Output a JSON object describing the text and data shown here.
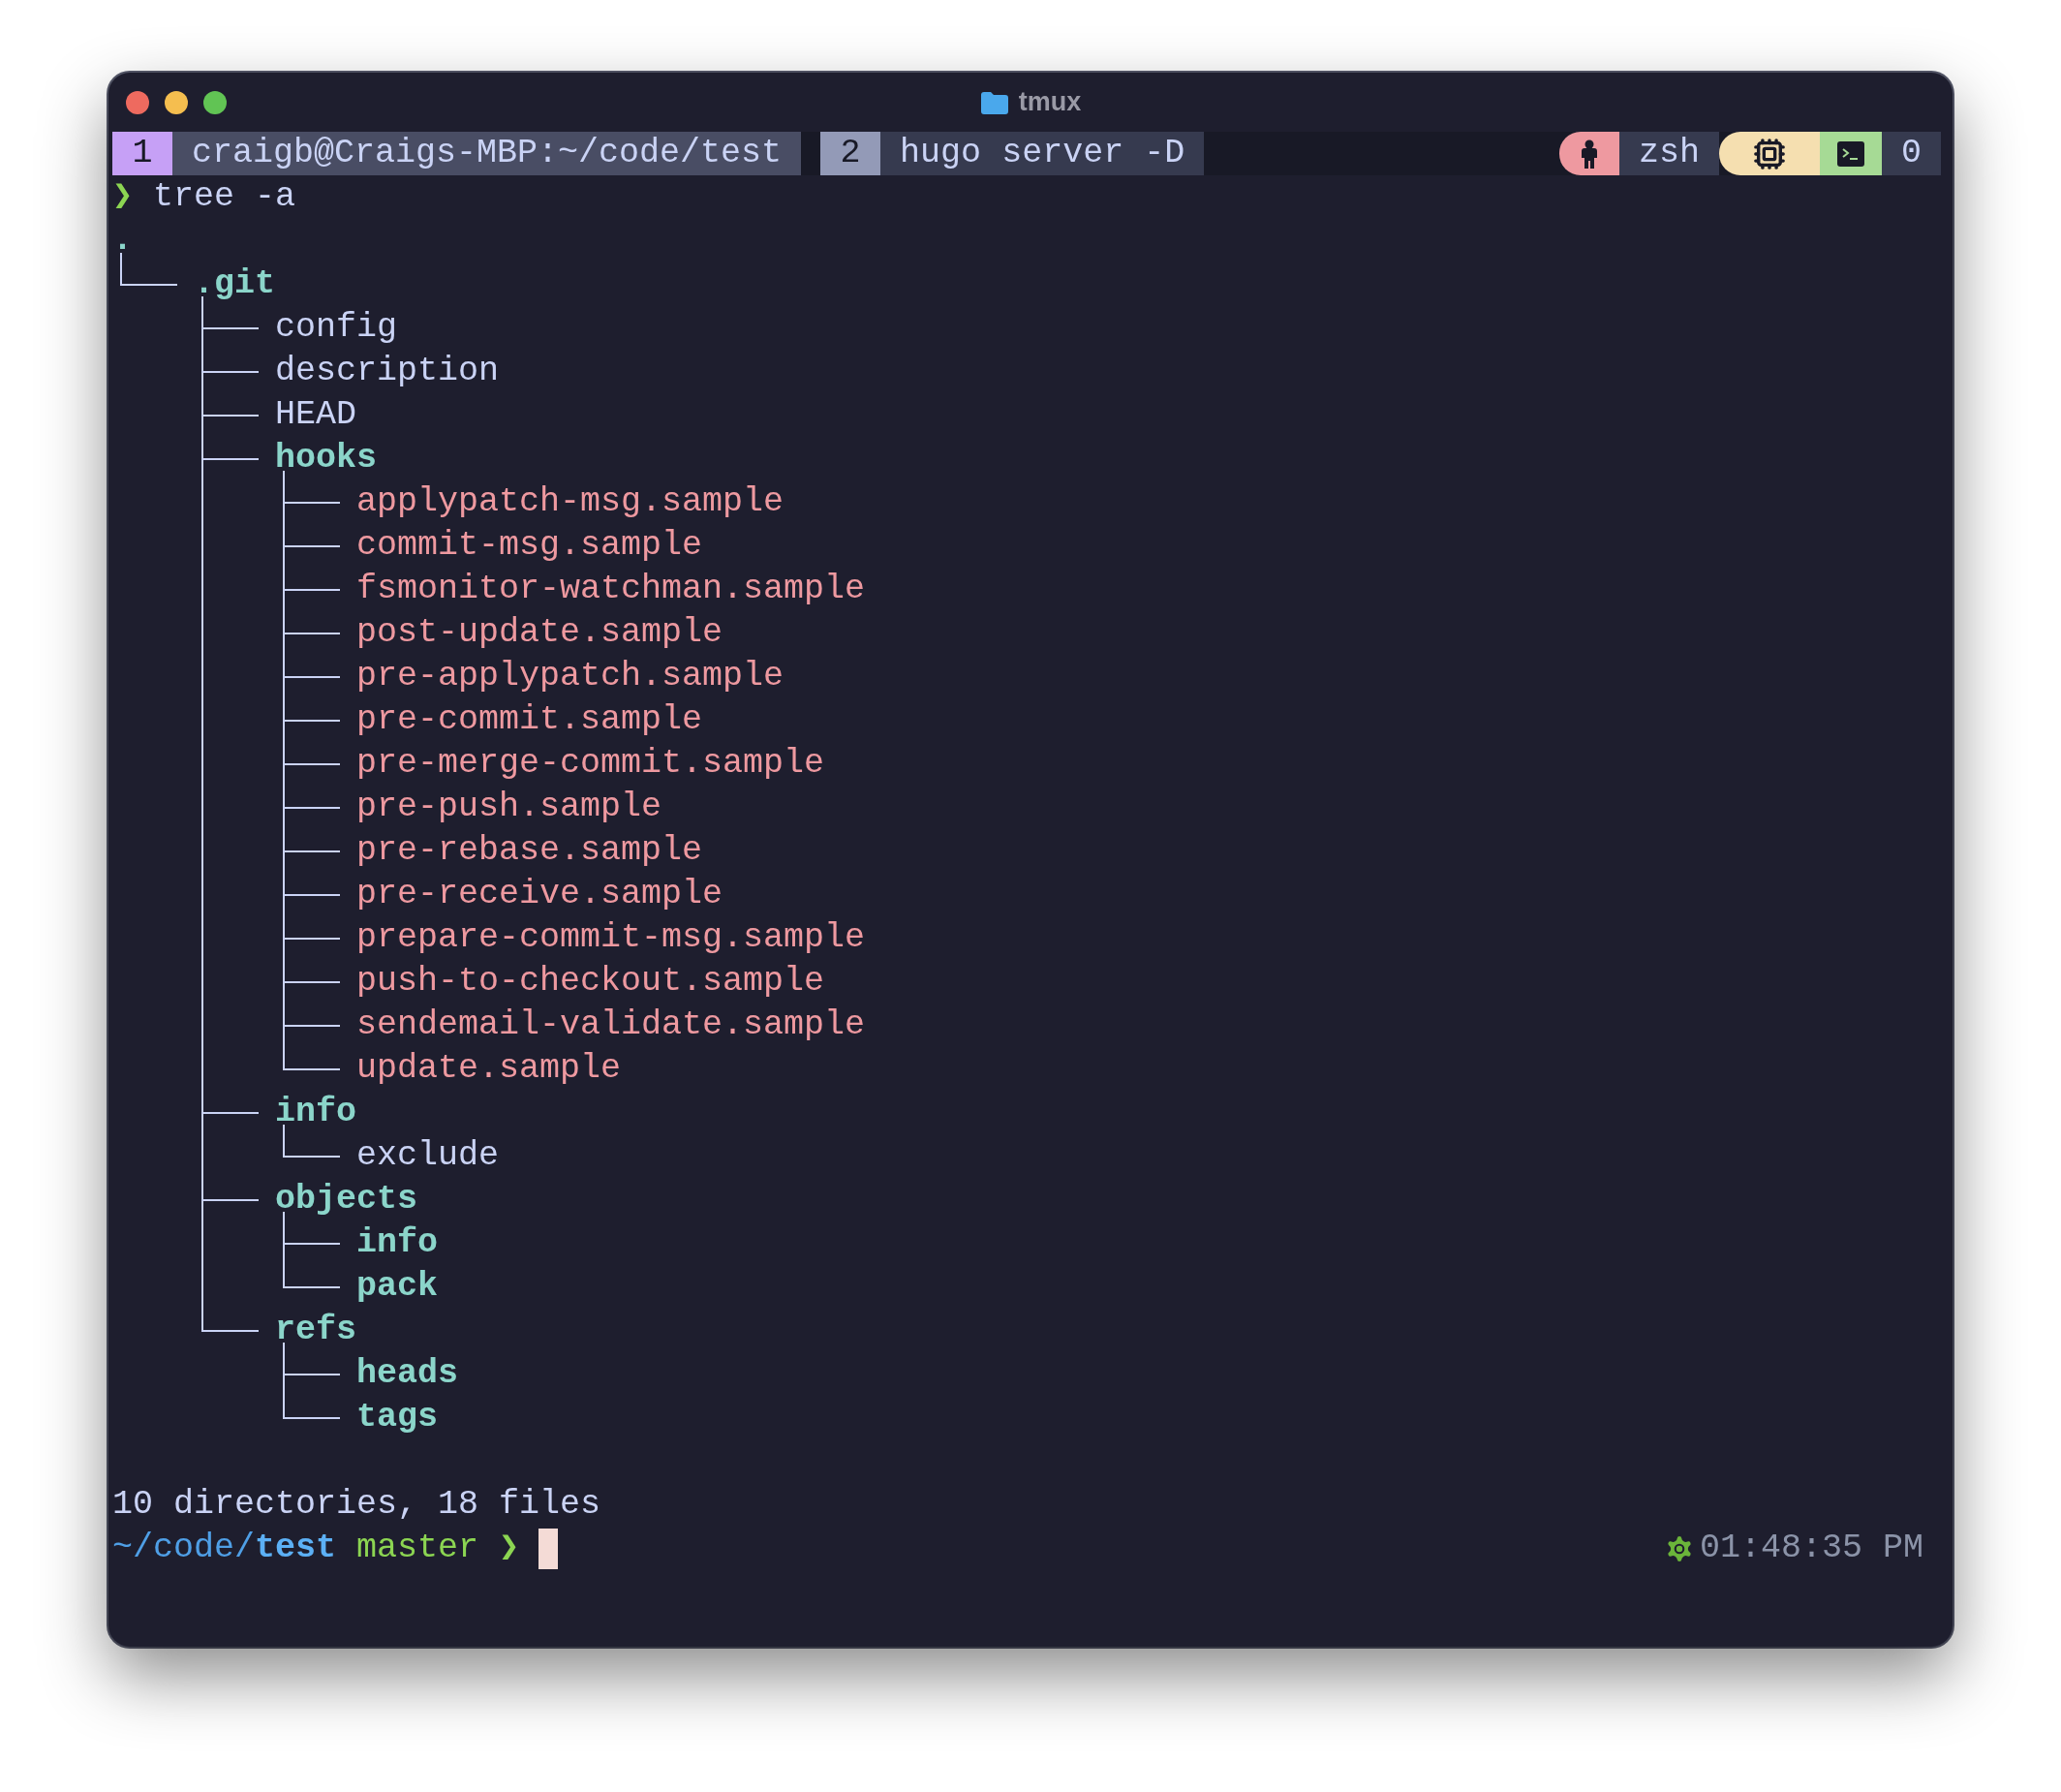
{
  "window": {
    "title": "tmux"
  },
  "tabs": [
    {
      "index": "1",
      "label": "craigb@Craigs-MBP:~/code/test",
      "selected": true
    },
    {
      "index": "2",
      "label": "hugo server -D",
      "selected": false
    }
  ],
  "status_right": {
    "session": "zsh",
    "windows": "0"
  },
  "command": {
    "symbol": "❯",
    "text": "tree -a"
  },
  "tree": {
    "name": ".",
    "kind": "dir",
    "children": [
      {
        "name": ".git",
        "kind": "dir",
        "children": [
          {
            "name": "config",
            "kind": "file"
          },
          {
            "name": "description",
            "kind": "file"
          },
          {
            "name": "HEAD",
            "kind": "file"
          },
          {
            "name": "hooks",
            "kind": "dir",
            "children": [
              {
                "name": "applypatch-msg.sample",
                "kind": "exec"
              },
              {
                "name": "commit-msg.sample",
                "kind": "exec"
              },
              {
                "name": "fsmonitor-watchman.sample",
                "kind": "exec"
              },
              {
                "name": "post-update.sample",
                "kind": "exec"
              },
              {
                "name": "pre-applypatch.sample",
                "kind": "exec"
              },
              {
                "name": "pre-commit.sample",
                "kind": "exec"
              },
              {
                "name": "pre-merge-commit.sample",
                "kind": "exec"
              },
              {
                "name": "pre-push.sample",
                "kind": "exec"
              },
              {
                "name": "pre-rebase.sample",
                "kind": "exec"
              },
              {
                "name": "pre-receive.sample",
                "kind": "exec"
              },
              {
                "name": "prepare-commit-msg.sample",
                "kind": "exec"
              },
              {
                "name": "push-to-checkout.sample",
                "kind": "exec"
              },
              {
                "name": "sendemail-validate.sample",
                "kind": "exec"
              },
              {
                "name": "update.sample",
                "kind": "exec"
              }
            ]
          },
          {
            "name": "info",
            "kind": "dir",
            "children": [
              {
                "name": "exclude",
                "kind": "file"
              }
            ]
          },
          {
            "name": "objects",
            "kind": "dir",
            "children": [
              {
                "name": "info",
                "kind": "dir"
              },
              {
                "name": "pack",
                "kind": "dir"
              }
            ]
          },
          {
            "name": "refs",
            "kind": "dir",
            "children": [
              {
                "name": "heads",
                "kind": "dir"
              },
              {
                "name": "tags",
                "kind": "dir"
              }
            ]
          }
        ]
      }
    ]
  },
  "summary": "10 directories, 18 files",
  "prompt": {
    "path_parent": "~/code/",
    "path_current": "test",
    "branch": "master",
    "symbol": "❯"
  },
  "clock": "01:48:35 PM"
}
